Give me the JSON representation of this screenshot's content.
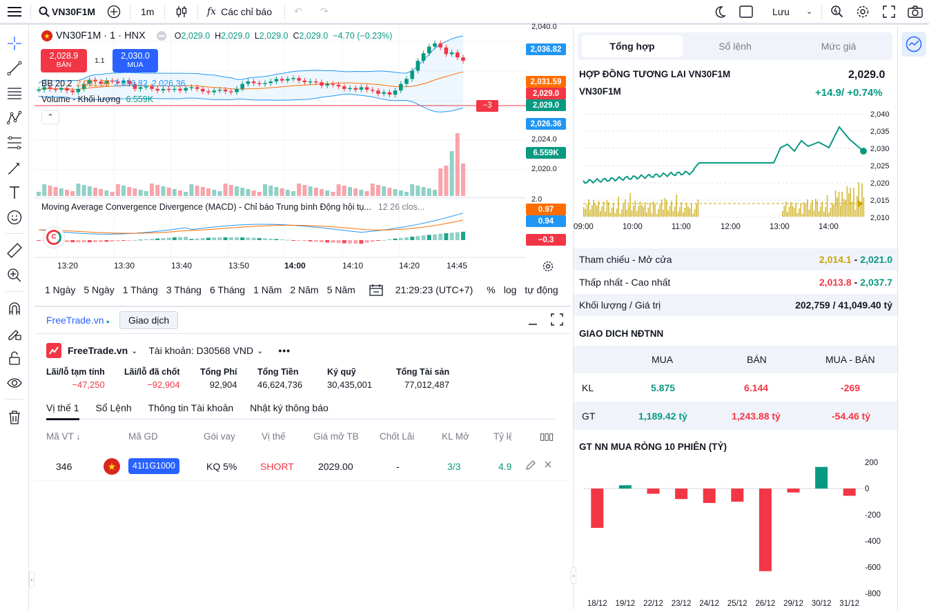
{
  "topbar": {
    "symbol": "VN30F1M",
    "interval": "1m",
    "indicators": "Các chỉ báo",
    "save": "Lưu"
  },
  "legend": {
    "title": "VN30F1M · 1 · HNX",
    "ohlc": {
      "o": "2,029.0",
      "h": "2,029.0",
      "l": "2,029.0",
      "c": "2,029.0",
      "chg": "−4.70 (−0.23%)"
    },
    "sell_price": "2,028.9",
    "sell_label": "BÁN",
    "spread": "1.1",
    "buy_price": "2,030.0",
    "buy_label": "MUA",
    "bb_label": "BB 20 2",
    "bb_mid": "2,031.59",
    "bb_up": "2,036.82",
    "bb_low": "2,026.36",
    "vol_label": "Volume - Khối lượng",
    "vol_val": "6.559K",
    "macd_label": "Moving Average Convergence Divergence (MACD) - Chỉ báo Trung bình Động hội tụ...",
    "macd_params": "12 26 clos..."
  },
  "price_axis": {
    "top": "2,040.0",
    "p2024": "2,024.0",
    "p2020": "2,020.0",
    "macd_top": "2.0"
  },
  "price_tags": {
    "upper": "2,036.82",
    "mid": "2,031.59",
    "price1": "2,029.0",
    "price2": "2,029.0",
    "lower": "2,026.36",
    "volume": "6.559K",
    "countdown": "−3",
    "macd1": "0.97",
    "macd2": "0.94",
    "hist": "−0.3"
  },
  "time_axis": [
    "13:20",
    "13:30",
    "13:40",
    "13:50",
    "14:00",
    "14:10",
    "14:20",
    "14:45"
  ],
  "periods": [
    "1 Ngày",
    "5 Ngày",
    "1 Tháng",
    "3 Tháng",
    "6 Tháng",
    "1 Năm",
    "2 Năm",
    "5 Năm"
  ],
  "clock": "21:29:23 (UTC+7)",
  "pct": "%",
  "log": "log",
  "auto": "tự động",
  "broker": {
    "site": "FreeTrade.vn",
    "trade_btn": "Giao dịch",
    "name": "FreeTrade.vn",
    "account": "Tài khoản: D30568 VND"
  },
  "summary": [
    {
      "label": "Lãi/lỗ tạm tính",
      "value": "−47,250"
    },
    {
      "label": "Lãi/lỗ đã chốt",
      "value": "−92,904"
    },
    {
      "label": "Tổng Phí",
      "value": "92,904"
    },
    {
      "label": "Tổng Tiền",
      "value": "46,624,736"
    },
    {
      "label": "Ký quỹ",
      "value": "30,435,001"
    },
    {
      "label": "Tổng Tài sản",
      "value": "77,012,487"
    }
  ],
  "bottom_tabs": [
    "Vị thế 1",
    "Sổ Lệnh",
    "Thông tin Tài khoản",
    "Nhật ký thông báo"
  ],
  "positions_header": [
    "Mã VT ↓",
    "Mã GD",
    "Gói vay",
    "Vị thế",
    "Giá mở TB",
    "Chốt Lãi",
    "KL Mở",
    "Tỷ lệ"
  ],
  "position": {
    "id": "346",
    "code": "41I1G1000",
    "loan": "KQ 5%",
    "side": "SHORT",
    "open": "2029.00",
    "tp": "-",
    "qty": "3/3",
    "ratio": "4.9"
  },
  "right": {
    "tabs": [
      "Tổng hợp",
      "Sổ lệnh",
      "Mức giá"
    ],
    "contract_title": "HỢP ĐỒNG TƯƠNG LAI VN30F1M",
    "price": "2,029.0",
    "symbol": "VN30F1M",
    "change": "+14.9/ +0.74%",
    "mini_y": [
      "2,040",
      "2,035",
      "2,030",
      "2,025",
      "2,020",
      "2,015",
      "2,010"
    ],
    "mini_x": [
      "09:00",
      "10:00",
      "11:00",
      "12:00",
      "13:00",
      "14:00"
    ],
    "ref_label": "Tham chiếu - Mở cửa",
    "ref_val": "2,014.1",
    "open_val": "2,021.0",
    "low_label": "Thấp nhất - Cao nhất",
    "low_val": "2,013.8",
    "high_val": "2,037.7",
    "vol_label": "Khối lượng / Giá trị",
    "vol_val": "202,759 / 41,049.40 tỷ",
    "nn_title": "GIAO DICH NĐTNN",
    "nn_cols": [
      "MUA",
      "BÁN",
      "MUA - BÁN"
    ],
    "kl_label": "KL",
    "kl": [
      "5.875",
      "6.144",
      "-269"
    ],
    "gt_label": "GT",
    "gt": [
      "1,189.42 tỷ",
      "1,243.88 tỷ",
      "-54.46 tỷ"
    ],
    "bar_title": "GT NN MUA RÒNG 10 PHIÊN (TỶ)"
  },
  "chart_data": {
    "type": "bar",
    "title": "GT NN MUA RÒNG 10 PHIÊN (TỶ)",
    "categories": [
      "18/12",
      "19/12",
      "22/12",
      "23/12",
      "24/12",
      "25/12",
      "26/12",
      "29/12",
      "30/12",
      "31/12"
    ],
    "values": [
      -300,
      25,
      -40,
      -80,
      -110,
      -100,
      -630,
      -30,
      165,
      -55
    ],
    "ylim": [
      -800,
      200
    ],
    "yticks": [
      "200",
      "0",
      "-200",
      "-400",
      "-600",
      "-800"
    ],
    "colors": {
      "pos": "#089981",
      "neg": "#f23645"
    }
  }
}
